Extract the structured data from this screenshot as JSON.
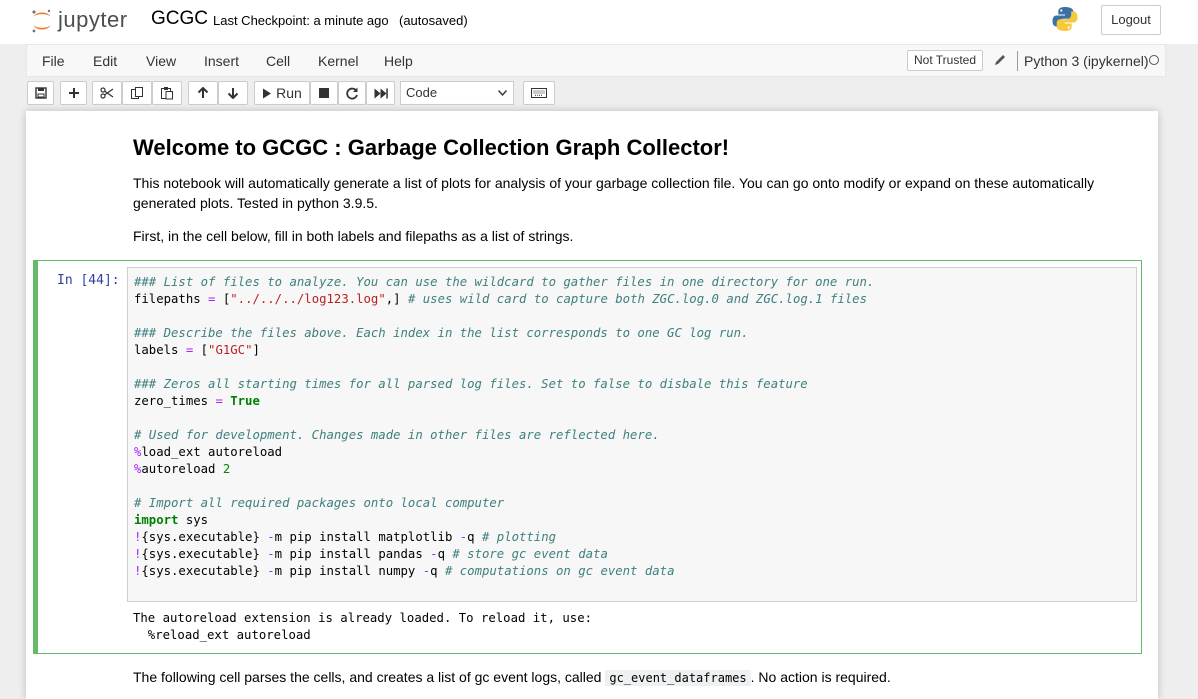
{
  "header": {
    "logo_text": "jupyter",
    "notebook_name": "GCGC",
    "checkpoint": "Last Checkpoint: a minute ago",
    "autosave": "(autosaved)",
    "logout_label": "Logout"
  },
  "menubar": {
    "items": [
      "File",
      "Edit",
      "View",
      "Insert",
      "Cell",
      "Kernel",
      "Help"
    ],
    "trust_label": "Not Trusted",
    "kernel_name": "Python 3 (ipykernel)"
  },
  "toolbar": {
    "run_label": "Run",
    "cell_type": "Code"
  },
  "notebook": {
    "heading": "Welcome to GCGC : Garbage Collection Graph Collector!",
    "intro": "This notebook will automatically generate a list of plots for analysis of your garbage collection file. You can go onto modify or expand on these automatically generated plots. Tested in python 3.9.5.",
    "instruction": "First, in the cell below, fill in both labels and filepaths as a list of strings.",
    "cell_prompt": "In [44]:",
    "output_line1": "The autoreload extension is already loaded. To reload it, use:",
    "output_line2": "  %reload_ext autoreload",
    "next_text_before": "The following cell parses the cells, and creates a list of gc event logs, called ",
    "next_code": "gc_event_dataframes",
    "next_text_after": ". No action is required."
  },
  "code_lines": [
    [
      {
        "t": "### List of files to analyze. You can use the wildcard to gather files in one directory for one run.",
        "c": "c"
      }
    ],
    [
      {
        "t": "filepaths ",
        "c": ""
      },
      {
        "t": "=",
        "c": "o"
      },
      {
        "t": " [",
        "c": ""
      },
      {
        "t": "\"../../../log123.log\"",
        "c": "s"
      },
      {
        "t": ",] ",
        "c": ""
      },
      {
        "t": "# uses wild card to capture both ZGC.log.0 and ZGC.log.1 files",
        "c": "c"
      }
    ],
    [
      {
        "t": "",
        "c": ""
      }
    ],
    [
      {
        "t": "### Describe the files above. Each index in the list corresponds to one GC log run.",
        "c": "c"
      }
    ],
    [
      {
        "t": "labels ",
        "c": ""
      },
      {
        "t": "=",
        "c": "o"
      },
      {
        "t": " [",
        "c": ""
      },
      {
        "t": "\"G1GC\"",
        "c": "s"
      },
      {
        "t": "]",
        "c": ""
      }
    ],
    [
      {
        "t": "",
        "c": ""
      }
    ],
    [
      {
        "t": "### Zeros all starting times for all parsed log files. Set to false to disbale this feature",
        "c": "c"
      }
    ],
    [
      {
        "t": "zero_times ",
        "c": ""
      },
      {
        "t": "=",
        "c": "o"
      },
      {
        "t": " ",
        "c": ""
      },
      {
        "t": "True",
        "c": "k"
      }
    ],
    [
      {
        "t": "",
        "c": ""
      }
    ],
    [
      {
        "t": "# Used for development. Changes made in other files are reflected here.",
        "c": "c"
      }
    ],
    [
      {
        "t": "%",
        "c": "o"
      },
      {
        "t": "load_ext autoreload",
        "c": ""
      }
    ],
    [
      {
        "t": "%",
        "c": "o"
      },
      {
        "t": "autoreload ",
        "c": ""
      },
      {
        "t": "2",
        "c": "m"
      }
    ],
    [
      {
        "t": "",
        "c": ""
      }
    ],
    [
      {
        "t": "# Import all required packages onto local computer",
        "c": "c"
      }
    ],
    [
      {
        "t": "import",
        "c": "k"
      },
      {
        "t": " sys",
        "c": ""
      }
    ],
    [
      {
        "t": "!",
        "c": "o"
      },
      {
        "t": "{sys.executable} ",
        "c": ""
      },
      {
        "t": "-",
        "c": "o"
      },
      {
        "t": "m pip install matplotlib ",
        "c": ""
      },
      {
        "t": "-",
        "c": "o"
      },
      {
        "t": "q ",
        "c": ""
      },
      {
        "t": "# plotting",
        "c": "c"
      }
    ],
    [
      {
        "t": "!",
        "c": "o"
      },
      {
        "t": "{sys.executable} ",
        "c": ""
      },
      {
        "t": "-",
        "c": "o"
      },
      {
        "t": "m pip install pandas ",
        "c": ""
      },
      {
        "t": "-",
        "c": "o"
      },
      {
        "t": "q ",
        "c": ""
      },
      {
        "t": "# store gc event data",
        "c": "c"
      }
    ],
    [
      {
        "t": "!",
        "c": "o"
      },
      {
        "t": "{sys.executable} ",
        "c": ""
      },
      {
        "t": "-",
        "c": "o"
      },
      {
        "t": "m pip install numpy ",
        "c": ""
      },
      {
        "t": "-",
        "c": "o"
      },
      {
        "t": "q ",
        "c": ""
      },
      {
        "t": "# computations on gc event data",
        "c": "c"
      }
    ]
  ],
  "icons": {
    "save": "save-icon",
    "add": "plus-icon",
    "cut": "scissors-icon",
    "copy": "copy-icon",
    "paste": "paste-icon",
    "up": "arrow-up-icon",
    "down": "arrow-down-icon",
    "run": "play-icon",
    "stop": "stop-icon",
    "restart": "restart-icon",
    "fast_forward": "fast-forward-icon",
    "keyboard": "keyboard-icon"
  },
  "colors": {
    "accent_green": "#66bb6a",
    "prompt_blue": "#303f9f",
    "jupyter_orange": "#f37726"
  }
}
